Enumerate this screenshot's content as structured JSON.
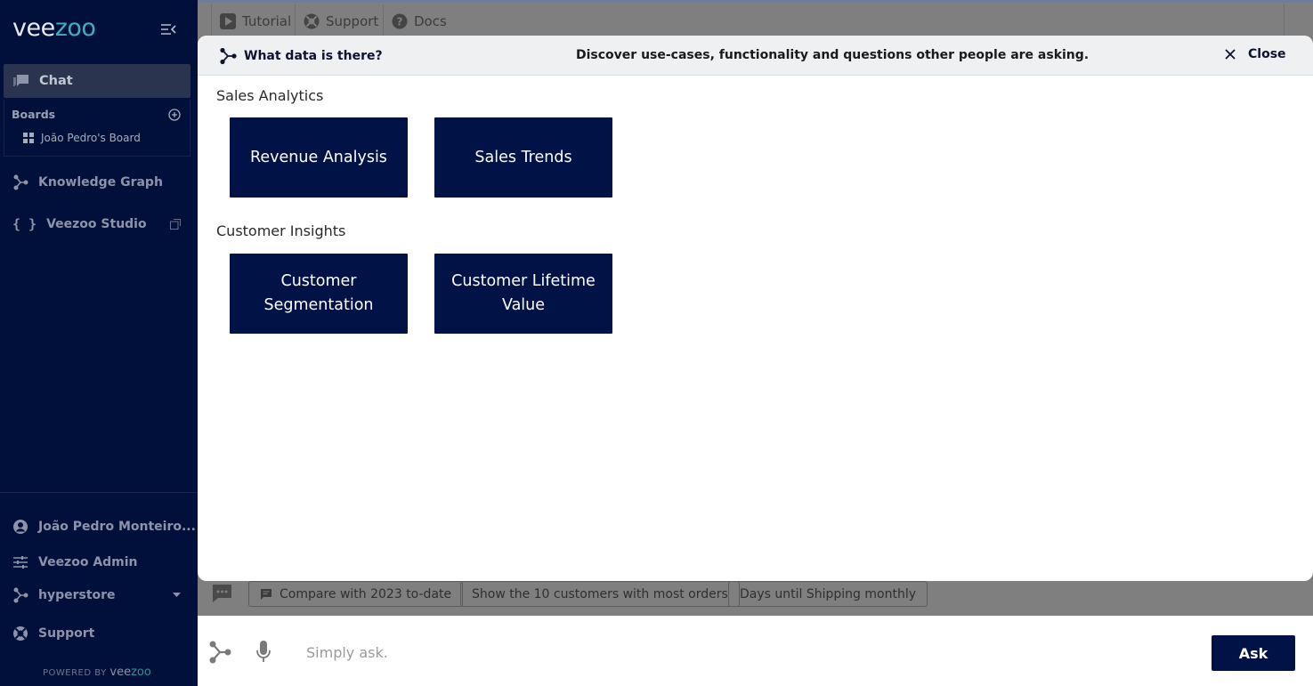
{
  "sidebar": {
    "logo": {
      "pre": "vee",
      "oo": "zoo"
    },
    "chat_label": "Chat",
    "boards_title": "Boards",
    "board_item": "João Pedro's Board",
    "knowledge_graph": "Knowledge Graph",
    "studio": "Veezoo Studio",
    "user": "João Pedro Monteiro...",
    "admin": "Veezoo Admin",
    "database": "hyperstore",
    "support": "Support",
    "powered_by": "POWERED BY",
    "powered_brand": {
      "pre": "vee",
      "oo": "zoo"
    }
  },
  "topbar": {
    "tutorial": "Tutorial",
    "support": "Support",
    "docs": "Docs"
  },
  "modal": {
    "header_left": "What data is there?",
    "header_center": "Discover use-cases, functionality and questions other people are asking.",
    "close_label": "Close",
    "sections": [
      {
        "title": "Sales Analytics",
        "cards": [
          "Revenue Analysis",
          "Sales Trends"
        ]
      },
      {
        "title": "Customer Insights",
        "cards": [
          "Customer Segmentation",
          "Customer Lifetime Value"
        ]
      }
    ]
  },
  "suggestions": [
    "Compare with 2023 to-date",
    "Show the 10 customers with most orders",
    "Days until Shipping monthly"
  ],
  "input": {
    "placeholder": "Simply ask.",
    "value": "",
    "ask_label": "Ask"
  },
  "colors": {
    "sidebar_bg": "#00103a",
    "accent": "#001246",
    "logo_teal": "#3fb0b8"
  }
}
